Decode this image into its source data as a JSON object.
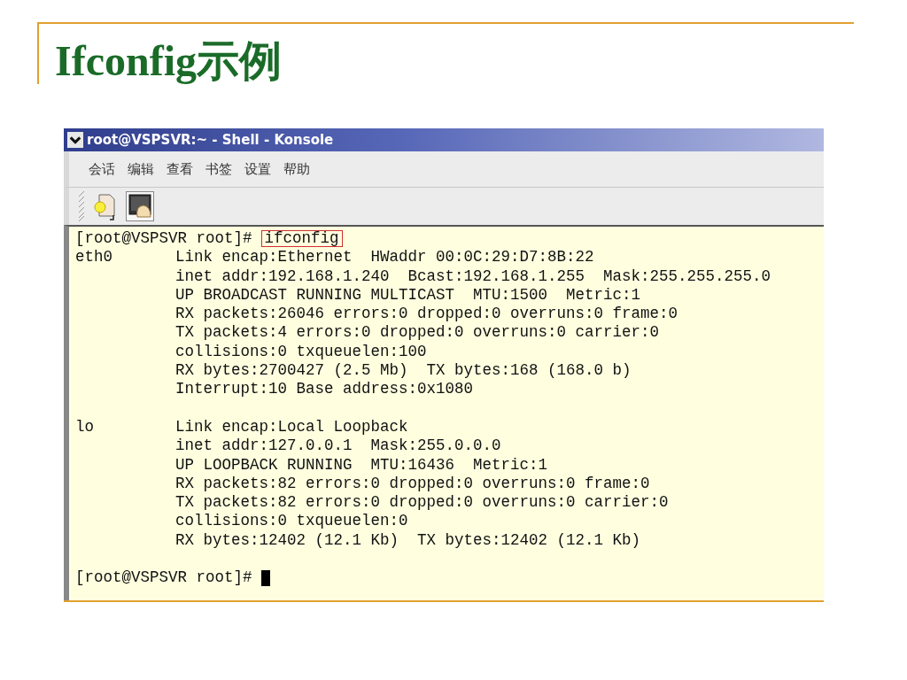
{
  "slide": {
    "title": "Ifconfig示例"
  },
  "window": {
    "title": "root@VSPSVR:~ - Shell - Konsole",
    "menu": [
      "会话",
      "编辑",
      "查看",
      "书签",
      "设置",
      "帮助"
    ],
    "terminal": {
      "command_line": {
        "prompt": "[root@VSPSVR root]#",
        "command": "ifconfig"
      },
      "interfaces": [
        {
          "name": "eth0",
          "lines": [
            "Link encap:Ethernet  HWaddr 00:0C:29:D7:8B:22",
            "inet addr:192.168.1.240  Bcast:192.168.1.255  Mask:255.255.255.0",
            "UP BROADCAST RUNNING MULTICAST  MTU:1500  Metric:1",
            "RX packets:26046 errors:0 dropped:0 overruns:0 frame:0",
            "TX packets:4 errors:0 dropped:0 overruns:0 carrier:0",
            "collisions:0 txqueuelen:100",
            "RX bytes:2700427 (2.5 Mb)  TX bytes:168 (168.0 b)",
            "Interrupt:10 Base address:0x1080"
          ]
        },
        {
          "name": "lo",
          "lines": [
            "Link encap:Local Loopback",
            "inet addr:127.0.0.1  Mask:255.0.0.0",
            "UP LOOPBACK RUNNING  MTU:16436  Metric:1",
            "RX packets:82 errors:0 dropped:0 overruns:0 frame:0",
            "TX packets:82 errors:0 dropped:0 overruns:0 carrier:0",
            "collisions:0 txqueuelen:0",
            "RX bytes:12402 (12.1 Kb)  TX bytes:12402 (12.1 Kb)"
          ]
        }
      ],
      "final_prompt": "[root@VSPSVR root]#"
    }
  }
}
